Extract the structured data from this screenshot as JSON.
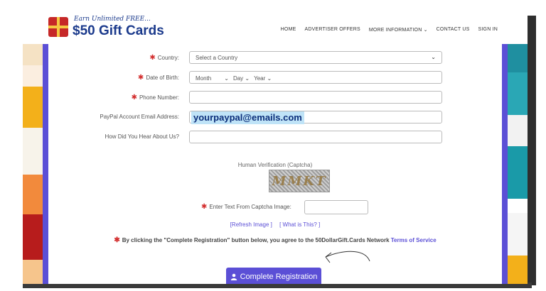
{
  "header": {
    "logo_tagline": "Earn Unlimited FREE...",
    "logo_text": "$50 Gift Cards",
    "nav": {
      "home": "HOME",
      "advertiser_offers": "ADVERTISER OFFERS",
      "more_information": "MORE INFORMATION ⌄",
      "contact_us": "CONTACT US",
      "sign_in": "SIGN IN"
    }
  },
  "form": {
    "country": {
      "label": "Country:",
      "value": "Select a Country"
    },
    "dob": {
      "label": "Date of Birth:",
      "month": "Month",
      "day": "Day",
      "year": "Year"
    },
    "phone": {
      "label": "Phone Number:",
      "value": ""
    },
    "paypal": {
      "label": "PayPal Account Email Address:",
      "value": "yourpaypal@emails.com"
    },
    "hear": {
      "label": "How Did You Hear About Us?",
      "value": ""
    },
    "captcha": {
      "title": "Human Verification (Captcha)",
      "image_text": "MMKT",
      "input_label": "Enter Text From Captcha Image:",
      "refresh_link": "[Refresh Image ]",
      "what_link": "[ What is This? ]"
    },
    "terms": {
      "text": "By clicking the \"Complete Registration\" button below, you agree to the 50DollarGift.Cards Network",
      "link": "Terms of Service"
    },
    "submit_label": "Complete Registration"
  },
  "colors": {
    "accent": "#5b4fd6",
    "required_star": "#d32f2f",
    "highlight": "#bfe3f7"
  }
}
